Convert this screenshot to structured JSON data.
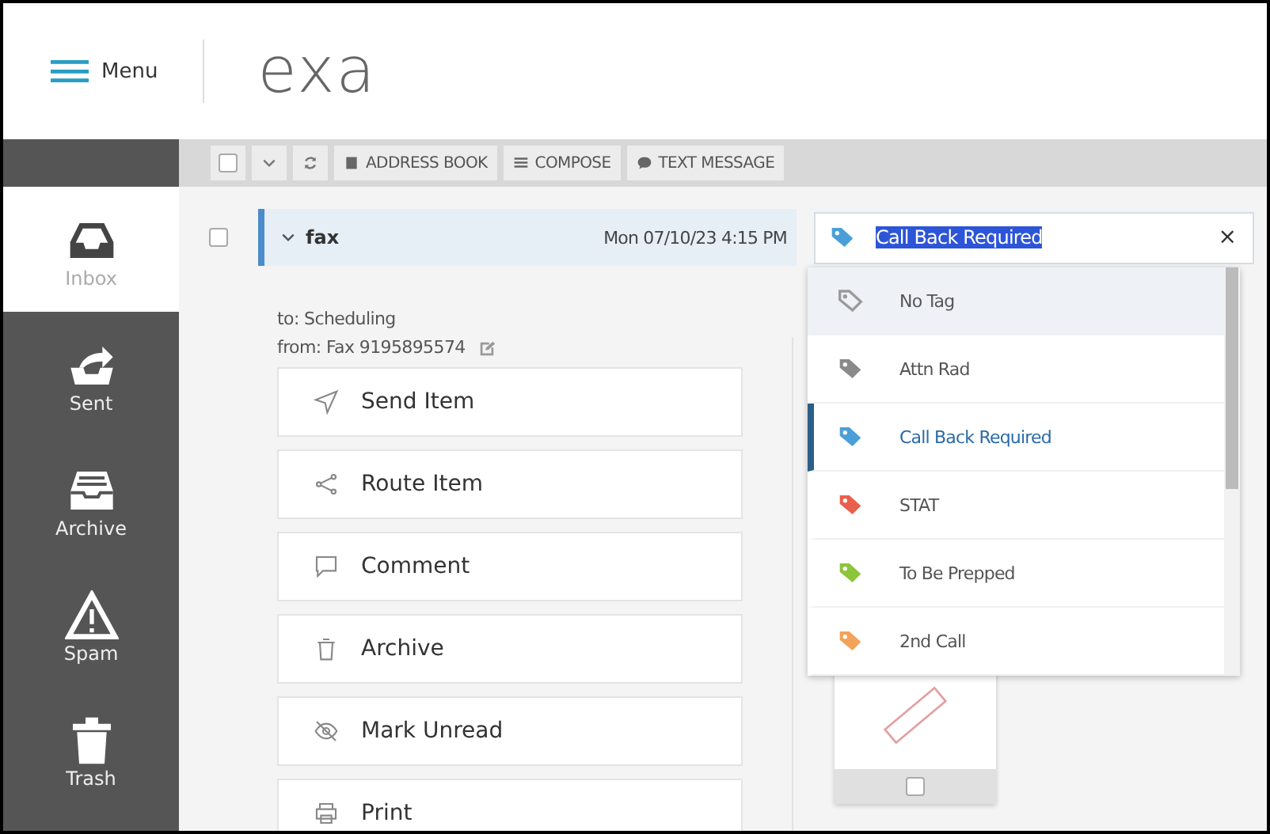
{
  "header": {
    "menu_label": "Menu",
    "logo": "exa"
  },
  "toolbar": {
    "select_all_checked": false,
    "buttons": [
      {
        "kind": "menu"
      },
      {
        "kind": "refresh"
      },
      {
        "kind": "text",
        "label": "ADDRESS BOOK"
      },
      {
        "kind": "text",
        "label": "COMPOSE"
      },
      {
        "kind": "text",
        "label": "TEXT MESSAGE"
      }
    ]
  },
  "sidebar": {
    "items": [
      {
        "label": "Inbox",
        "selected": true
      },
      {
        "label": "Sent",
        "selected": false
      },
      {
        "label": "Archive",
        "selected": false
      },
      {
        "label": "Spam",
        "selected": false
      },
      {
        "label": "Trash",
        "selected": false
      }
    ]
  },
  "message": {
    "checked": false,
    "expanded": true,
    "subject": "fax",
    "date": "Mon 07/10/23 4:15 PM",
    "to": "to: Scheduling",
    "from": "from: Fax 9195895574",
    "tag_field": {
      "value": "Call Back Required",
      "color": "#4a9fd8",
      "text_highlighted": true,
      "clear": "×"
    },
    "tag_options": [
      {
        "label": "No Tag",
        "color": "#9a9a9a",
        "selected": false,
        "hovered": true
      },
      {
        "label": "Attn Rad",
        "color": "#8a8a8a",
        "selected": false,
        "hovered": false
      },
      {
        "label": "Call Back Required",
        "color": "#4a9fd8",
        "selected": true,
        "hovered": false
      },
      {
        "label": "STAT",
        "color": "#e8604c",
        "selected": false,
        "hovered": false
      },
      {
        "label": "To Be Prepped",
        "color": "#8cc43c",
        "selected": false,
        "hovered": false
      },
      {
        "label": "2nd Call",
        "color": "#f4a259",
        "selected": false,
        "hovered": false
      }
    ],
    "actions": [
      "Send Item",
      "Route Item",
      "Comment",
      "Archive",
      "Mark Unread",
      "Print"
    ],
    "attachment": {
      "checked": false
    }
  }
}
